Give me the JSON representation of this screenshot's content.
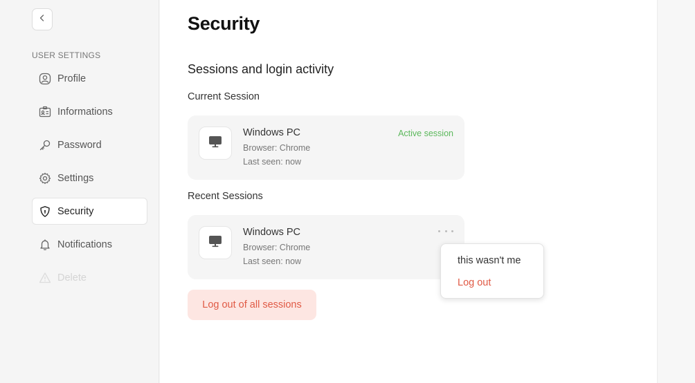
{
  "sidebar": {
    "section_label": "USER SETTINGS",
    "items": [
      {
        "label": "Profile",
        "icon": "user-circle-icon"
      },
      {
        "label": "Informations",
        "icon": "id-card-icon"
      },
      {
        "label": "Password",
        "icon": "key-icon"
      },
      {
        "label": "Settings",
        "icon": "gear-icon"
      },
      {
        "label": "Security",
        "icon": "shield-icon",
        "active": true
      },
      {
        "label": "Notifications",
        "icon": "bell-icon"
      },
      {
        "label": "Delete",
        "icon": "warning-icon",
        "disabled": true
      }
    ]
  },
  "main": {
    "title": "Security",
    "sessions_heading": "Sessions and login activity",
    "current_heading": "Current Session",
    "recent_heading": "Recent Sessions",
    "current_session": {
      "device": "Windows PC",
      "browser": "Browser: Chrome",
      "last_seen": "Last seen: now",
      "status": "Active session"
    },
    "recent_session": {
      "device": "Windows PC",
      "browser": "Browser: Chrome",
      "last_seen": "Last seen: now"
    },
    "dropdown": {
      "item1": "this wasn't me",
      "item2": "Log out"
    },
    "logout_all_label": "Log out of all sessions"
  },
  "colors": {
    "accent_green": "#5cb85c",
    "danger": "#e05a45",
    "danger_bg": "#fde6e2"
  }
}
